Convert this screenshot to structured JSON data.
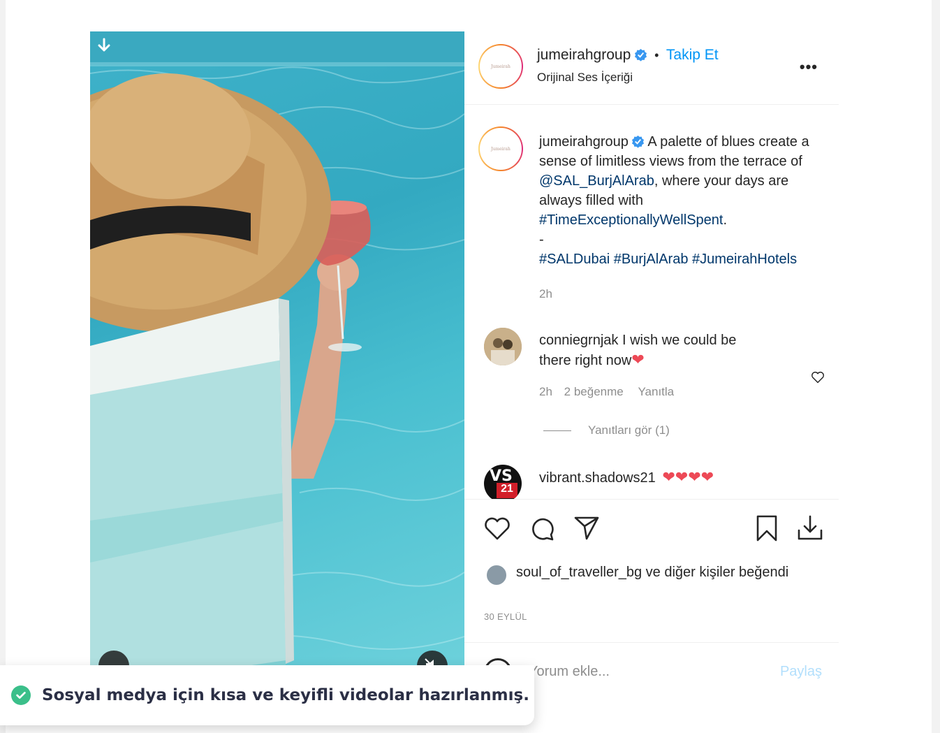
{
  "post": {
    "username": "jumeirahgroup",
    "separator": "•",
    "follow_label": "Takip Et",
    "audio_label": "Orijinal Ses İçeriği",
    "more_label": "•••",
    "avatar_logo": "Jumeirah"
  },
  "caption": {
    "username": "jumeirahgroup",
    "text_1": " A palette of blues create a sense of limitless views from the terrace of ",
    "mention": "@SAL_BurjAlArab",
    "text_2": ", where your days are always filled with ",
    "hashtag_main": "#TimeExceptionallyWellSpent",
    "text_3": ".",
    "dash": "-",
    "hashtags": "#SALDubai #BurjAlArab #JumeirahHotels",
    "time": "2h"
  },
  "comments": [
    {
      "username": "conniegrnjak",
      "text": " I wish we could be there right now",
      "emoji": "❤",
      "time": "2h",
      "likes": "2 beğenme",
      "reply_label": "Yanıtla",
      "view_replies": "Yanıtları gör (1)"
    },
    {
      "username": "vibrant.shadows21",
      "emoji": "❤❤❤❤",
      "avatar_text": "VS",
      "avatar_sub": "21"
    }
  ],
  "likes": {
    "user": "soul_of_traveller_bg",
    "rest": " ve diğer kişiler beğendi"
  },
  "date": "30 EYLÜL",
  "comment_input": {
    "placeholder": "Yorum ekle...",
    "share_label": "Paylaş"
  },
  "toast": {
    "text": "Sosyal medya için kısa ve keyifli videolar hazırlanmış."
  },
  "colors": {
    "link": "#0095f6",
    "mention": "#00376b",
    "heart": "#ed4956",
    "toast_check": "#3bbf8a"
  }
}
